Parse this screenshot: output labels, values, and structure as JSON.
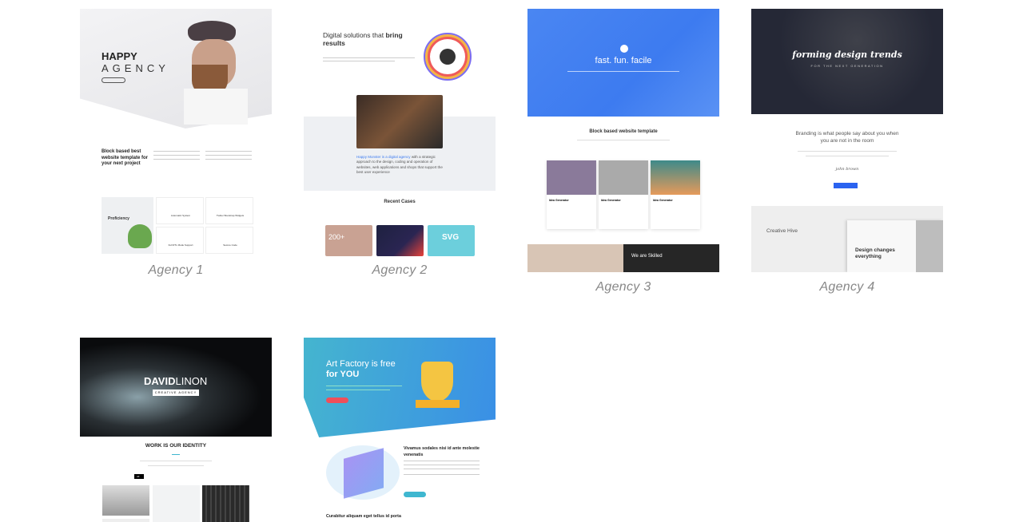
{
  "templates": [
    {
      "caption": "Agency 1",
      "hero_title_1": "HAPPY",
      "hero_title_2": "AGENCY",
      "section_title": "Block based best website template for your next project",
      "panel_title": "Proficiency",
      "features": [
        "Automatic System",
        "Twitter Bootstrap Widgets",
        "Full RTL Mode Support",
        "Secure Code"
      ]
    },
    {
      "caption": "Agency 2",
      "hero_title": "Digital solutions that",
      "hero_title_bold": "bring results",
      "intro_link": "Happy Monster is a digital agency",
      "intro_text": "with a strategic approach to the design, coding and operation of websites, web applications and shops that support the best user experience",
      "section_title": "Recent Cases",
      "case_1": "200+",
      "case_3": "SVG"
    },
    {
      "caption": "Agency 3",
      "hero_title": "fast. fun. facile",
      "section_title": "Block based website template",
      "card_title": "Idea Generator",
      "banner_title": "We are Skilled"
    },
    {
      "caption": "Agency 4",
      "hero_title": "forming design trends",
      "hero_sub": "FOR THE NEXT GENERATION",
      "quote": "Branding is what people say about you when you are not in the room",
      "signature": "john brown",
      "brand": "Creative Hive",
      "promo": "Design changes everything"
    },
    {
      "caption": "",
      "hero_bold": "DAVID",
      "hero_light": "LINON",
      "hero_tag": "CREATIVE AGENCY",
      "section_title": "WORK IS OUR IDENTITY",
      "filter_active": "All"
    },
    {
      "caption": "",
      "hero_title": "Art Factory is free",
      "hero_bold": "for YOU",
      "feature_title": "Vivamus sodales nisi id ante molestie venenatis",
      "footer_title": "Curabitur aliquam eget tellus id porta"
    }
  ],
  "colors": {
    "blue": "#3d7bf0",
    "dark": "#252836",
    "teal": "#3fb7d0",
    "caption": "#888888"
  }
}
